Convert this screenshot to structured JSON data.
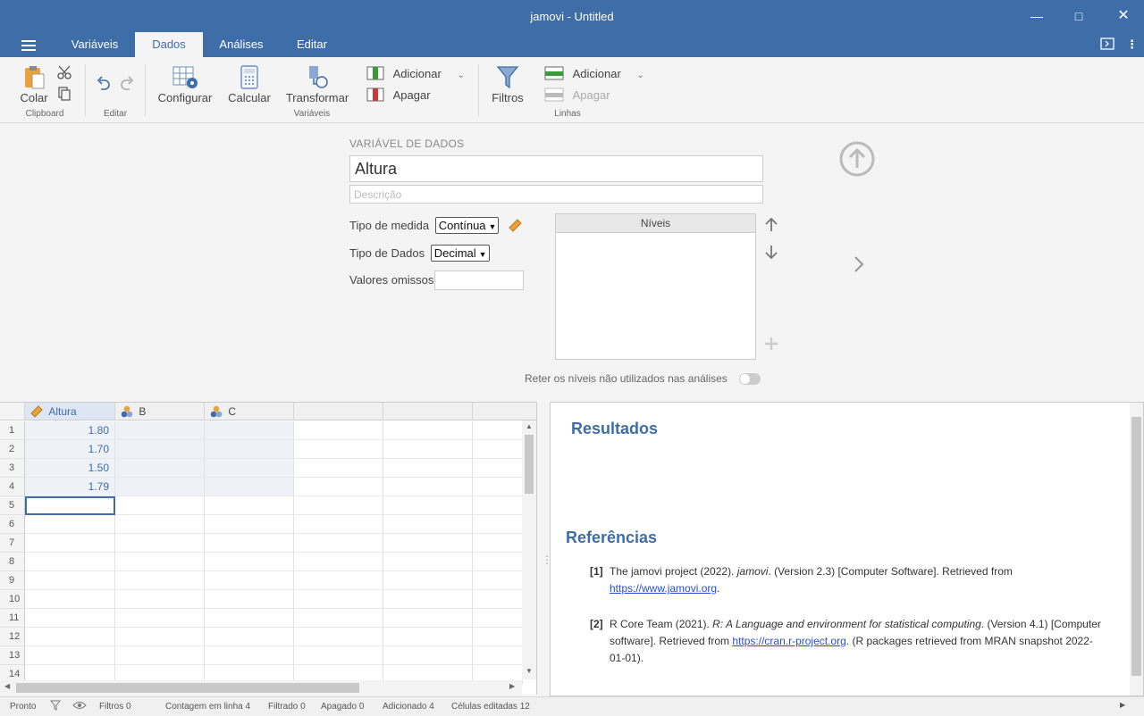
{
  "window": {
    "title": "jamovi - Untitled"
  },
  "menu": {
    "tabs": [
      {
        "label": "Variáveis"
      },
      {
        "label": "Dados"
      },
      {
        "label": "Análises"
      },
      {
        "label": "Editar"
      }
    ]
  },
  "ribbon": {
    "clipboard": {
      "paste_label": "Colar",
      "group_label": "Clipboard"
    },
    "edit": {
      "group_label": "Editar"
    },
    "variables": {
      "setup_label": "Configurar",
      "compute_label": "Calcular",
      "transform_label": "Transformar",
      "add_label": "Adicionar",
      "delete_label": "Apagar",
      "group_label": "Variáveis"
    },
    "rows": {
      "filters_label": "Filtros",
      "add_label": "Adicionar",
      "delete_label": "Apagar",
      "group_label": "Linhas"
    }
  },
  "variable_editor": {
    "section_label": "VARIÁVEL DE DADOS",
    "name": "Altura",
    "description_placeholder": "Descrição",
    "measure_type_label": "Tipo de medida",
    "measure_type_value": "Contínua",
    "data_type_label": "Tipo de Dados",
    "data_type_value": "Decimal",
    "missing_label": "Valores omissos",
    "levels_header": "Níveis",
    "retain_label": "Reter os níveis não utilizados nas análises"
  },
  "sheet": {
    "columns": [
      {
        "name": "Altura",
        "icon": "ruler-icon"
      },
      {
        "name": "B",
        "icon": "nominal-icon"
      },
      {
        "name": "C",
        "icon": "nominal-icon"
      }
    ],
    "rows": [
      "1",
      "2",
      "3",
      "4",
      "5",
      "6",
      "7",
      "8",
      "9",
      "10",
      "11",
      "12",
      "13",
      "14"
    ],
    "values": [
      "1.80",
      "1.70",
      "1.50",
      "1.79"
    ]
  },
  "results": {
    "title": "Resultados",
    "references_title": "Referências",
    "refs": [
      {
        "num": "[1]",
        "pre": "The jamovi project (2022). ",
        "em": "jamovi",
        "mid": ". (Version 2.3) [Computer Software]. Retrieved from ",
        "link": "https://www.jamovi.org",
        "post": "."
      },
      {
        "num": "[2]",
        "pre": "R Core Team (2021). ",
        "em": "R: A Language and environment for statistical computing",
        "mid": ". (Version 4.1) [Computer software]. Retrieved from ",
        "link": "https://cran.r-project.org",
        "post": ". (R packages retrieved from MRAN snapshot 2022-01-01)."
      }
    ]
  },
  "status": {
    "ready": "Pronto",
    "filters": "Filtros 0",
    "row_count": "Contagem em linha 4",
    "filtered": "Filtrado 0",
    "deleted": "Apagado 0",
    "added": "Adicionado 4",
    "edited": "Células editadas 12"
  },
  "colors": {
    "accent": "#3e6da8",
    "ruler": "#e8a33a",
    "link": "#2a4fd6"
  }
}
